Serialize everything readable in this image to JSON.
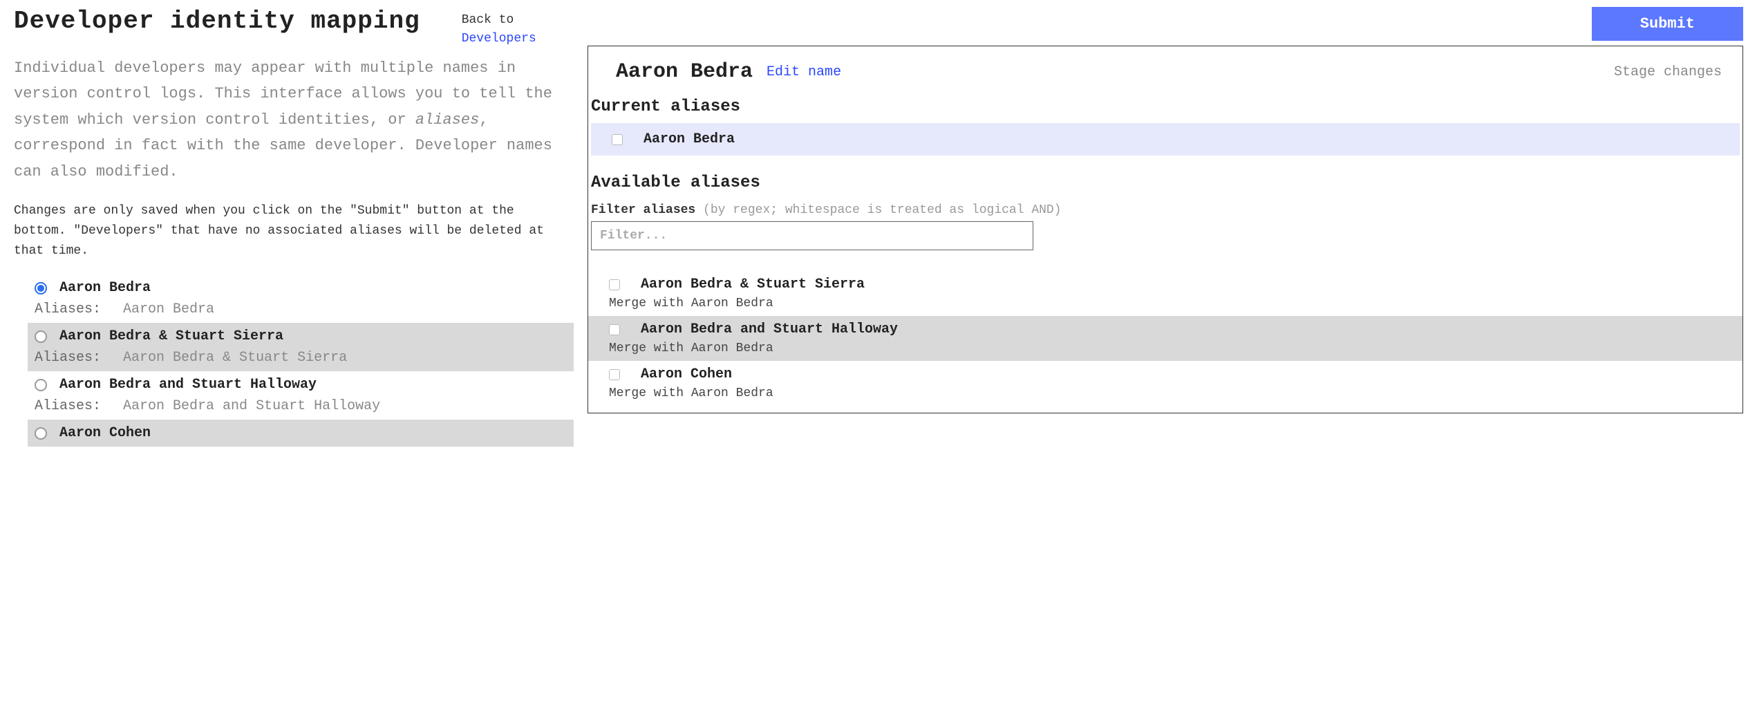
{
  "header": {
    "title": "Developer identity mapping",
    "back_prefix": "Back to",
    "back_link": "Developers"
  },
  "description_part1": "Individual developers may appear with multiple names in version control logs. This interface allows you to tell the system which version control identities, or ",
  "description_italic": "aliases",
  "description_part2": ", correspond in fact with the same developer. Developer names can also modified.",
  "subnote": "Changes are only saved when you click on the \"Submit\" button at the bottom. \"Developers\" that have no associated aliases will be deleted at that time.",
  "aliases_label": "Aliases:",
  "developers": [
    {
      "name": "Aaron Bedra",
      "aliases": "Aaron Bedra",
      "selected": true
    },
    {
      "name": "Aaron Bedra & Stuart Sierra",
      "aliases": "Aaron Bedra & Stuart Sierra",
      "selected": false
    },
    {
      "name": "Aaron Bedra and Stuart Halloway",
      "aliases": "Aaron Bedra and Stuart Halloway",
      "selected": false
    },
    {
      "name": "Aaron Cohen",
      "aliases": "",
      "selected": false
    }
  ],
  "submit_label": "Submit",
  "detail": {
    "title": "Aaron Bedra",
    "edit_name": "Edit name",
    "stage_changes": "Stage changes",
    "current_heading": "Current aliases",
    "current_aliases": [
      {
        "name": "Aaron Bedra"
      }
    ],
    "available_heading": "Available aliases",
    "filter_label": "Filter aliases",
    "filter_hint": "(by regex; whitespace is treated as logical AND)",
    "filter_placeholder": "Filter...",
    "merge_prefix": "Merge with",
    "merge_target": "Aaron Bedra",
    "available_aliases": [
      {
        "name": "Aaron Bedra & Stuart Sierra"
      },
      {
        "name": "Aaron Bedra and Stuart Halloway"
      },
      {
        "name": "Aaron Cohen"
      }
    ]
  }
}
